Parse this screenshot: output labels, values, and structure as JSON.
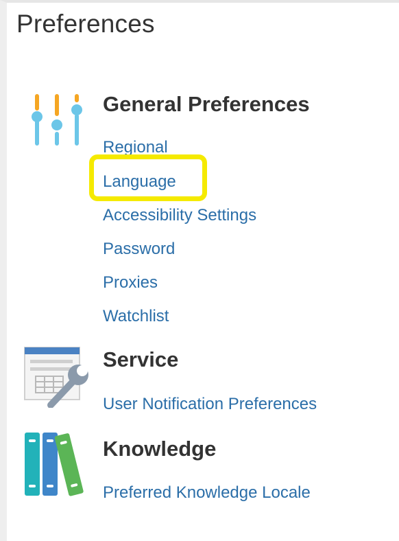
{
  "page": {
    "title": "Preferences"
  },
  "sections": [
    {
      "heading": "General Preferences",
      "icon": "sliders-icon",
      "links": [
        "Regional",
        "Language",
        "Accessibility Settings",
        "Password",
        "Proxies",
        "Watchlist"
      ]
    },
    {
      "heading": "Service",
      "icon": "service-tools-icon",
      "links": [
        "User Notification Preferences"
      ]
    },
    {
      "heading": "Knowledge",
      "icon": "books-icon",
      "links": [
        "Preferred Knowledge Locale"
      ]
    }
  ],
  "highlight": {
    "target": "Language",
    "color": "#f5ea00"
  },
  "colors": {
    "link": "#2b6ea8",
    "heading": "#333333"
  }
}
